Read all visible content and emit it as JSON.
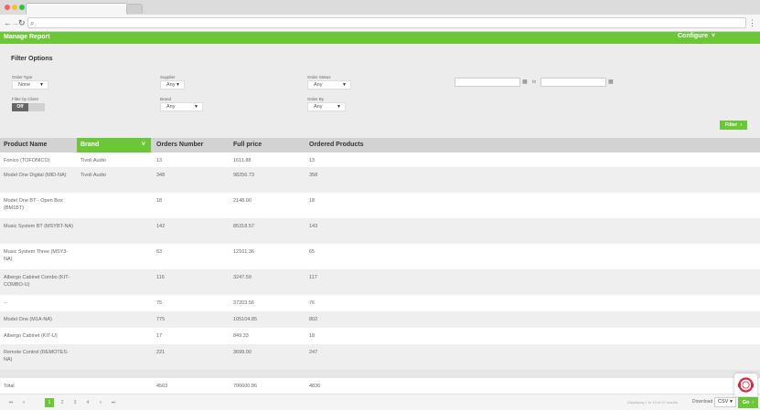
{
  "browser": {
    "dots": [
      "#ff5f57",
      "#febc2e",
      "#28c840"
    ],
    "address_value": ""
  },
  "header": {
    "title": "Manage Report",
    "configure_label": "Configure"
  },
  "filters": {
    "title": "Filter Options",
    "order_type": {
      "label": "Order Type",
      "value": "None"
    },
    "supplier": {
      "label": "Supplier",
      "value": "Any"
    },
    "order_status": {
      "label": "Order Status",
      "value": "Any"
    },
    "filter_by_client": {
      "label": "Filter by Client",
      "state": "Off"
    },
    "brand": {
      "label": "Brand",
      "value": "Any"
    },
    "order_by": {
      "label": "Order By",
      "value": "Any"
    },
    "date_to_label": "to",
    "filter_button": "Filter"
  },
  "table": {
    "columns": [
      "Product Name",
      "Brand",
      "Orders Number",
      "Full price",
      "Ordered Products"
    ],
    "rows": [
      {
        "name": "Fonico (TOFONICO)",
        "brand": "Tivoli Audio",
        "orders": "13",
        "price": "1611.88",
        "products": "13"
      },
      {
        "name": "Model One Digital (MID-NA)",
        "brand": "Tivoli Audio",
        "orders": "348",
        "price": "98256.73",
        "products": "358"
      },
      {
        "name": "Model One BT - Open Box (BM1BT)",
        "brand": "",
        "orders": "18",
        "price": "2148.00",
        "products": "18"
      },
      {
        "name": "Music System BT (MSYBT-NA)",
        "brand": "",
        "orders": "142",
        "price": "85318.57",
        "products": "143"
      },
      {
        "name": "Music System Three (MSY3-NA)",
        "brand": "",
        "orders": "63",
        "price": "12101.36",
        "products": "65"
      },
      {
        "name": "Albergo Cabinet Combo (KIT-COMBO-U)",
        "brand": "",
        "orders": "116",
        "price": "3247.59",
        "products": "117"
      },
      {
        "name": "--",
        "brand": "",
        "orders": "75",
        "price": "37203.56",
        "products": "76"
      },
      {
        "name": "Model One (M1A-NA)",
        "brand": "",
        "orders": "775",
        "price": "105104.85",
        "products": "802"
      },
      {
        "name": "Albergo Cabinet (KIT-U)",
        "brand": "",
        "orders": "17",
        "price": "849.33",
        "products": "18"
      },
      {
        "name": "Remote Control (REMOTES-NA)",
        "brand": "",
        "orders": "221",
        "price": "3699.00",
        "products": "247"
      },
      {
        "name": "",
        "brand": "",
        "orders": "",
        "price": "",
        "products": ""
      },
      {
        "name": "Total",
        "brand": "",
        "orders": "4503",
        "price": "706600.86",
        "products": "4836"
      }
    ]
  },
  "pager": {
    "buttons": [
      "⏮",
      "«",
      "1",
      "2",
      "3",
      "4",
      "»",
      "⏭"
    ],
    "active_page": "1",
    "display_text": "Displaying 1 to 10 of 37 results",
    "download_label": "Download",
    "format_value": "CSV",
    "go_label": "Go"
  },
  "colors": {
    "accent": "#6cc738",
    "chat_ring": "#e5243b"
  }
}
